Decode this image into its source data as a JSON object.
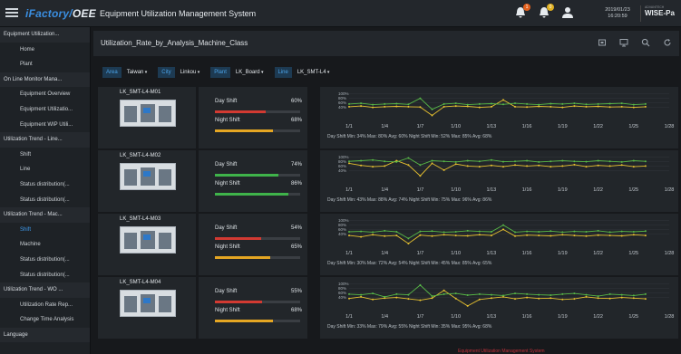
{
  "app": {
    "brand_prefix": "iFactory/",
    "brand_suffix": "OEE",
    "system_title": "Equipment Utilization Management System",
    "date": "2019/01/23",
    "time": "16:20:59",
    "vendor_small": "ADVANTECH",
    "vendor_big": "WISE-Pa",
    "alarm_badge": "1",
    "notice_badge": "0"
  },
  "sidebar": {
    "items": [
      {
        "label": "Equipment Utilization...",
        "level": "head"
      },
      {
        "label": "Home",
        "level": "sub"
      },
      {
        "label": "Plant",
        "level": "sub"
      },
      {
        "label": "On Line Monitor Mana...",
        "level": "head"
      },
      {
        "label": "Equipment Overview",
        "level": "sub"
      },
      {
        "label": "Equipment Utilizatio...",
        "level": "sub"
      },
      {
        "label": "Equipment WIP Utili...",
        "level": "sub"
      },
      {
        "label": "Utilization Trend - Line...",
        "level": "head"
      },
      {
        "label": "Shift",
        "level": "sub"
      },
      {
        "label": "Line",
        "level": "sub"
      },
      {
        "label": "Status distribution(...",
        "level": "sub"
      },
      {
        "label": "Status distribution(...",
        "level": "sub"
      },
      {
        "label": "Utilization Trend - Mac...",
        "level": "head"
      },
      {
        "label": "Shift",
        "level": "sub",
        "active": true
      },
      {
        "label": "Machine",
        "level": "sub"
      },
      {
        "label": "Status distribution(...",
        "level": "sub"
      },
      {
        "label": "Status distribution(...",
        "level": "sub"
      },
      {
        "label": "Utilization Trend - WO ...",
        "level": "head"
      },
      {
        "label": "Utilization Rate Rep...",
        "level": "sub"
      },
      {
        "label": "Change Time Analysis",
        "level": "sub"
      },
      {
        "label": "Language",
        "level": "head"
      }
    ]
  },
  "page": {
    "title": "Utilization_Rate_by_Analysis_Machine_Class"
  },
  "filters": [
    {
      "label": "Area",
      "value": "Taiwan"
    },
    {
      "label": "City",
      "value": "Linkou"
    },
    {
      "label": "Plant",
      "value": "LK_Board"
    },
    {
      "label": "Line",
      "value": "LK_SMT-L4"
    }
  ],
  "colors": {
    "day": "#e7c12f",
    "night": "#58b947",
    "bar_red": "#d23a32",
    "bar_yellow": "#e5a623",
    "bar_green": "#3fb34a"
  },
  "machines": [
    {
      "name": "LK_SMT-L4-M01",
      "day_label": "Day Shift",
      "day_pct": "60%",
      "day_value": 0.6,
      "night_label": "Night Shift",
      "night_pct": "68%",
      "night_value": 0.68,
      "day_bar_color": "#d23a32",
      "night_bar_color": "#e5a623",
      "legend": "Day Shift Min: 34% Max: 80% Avg: 60%  Night Shift Min: 52% Max: 85% Avg: 68%"
    },
    {
      "name": "LK_SMT-L4-M02",
      "day_label": "Day Shift",
      "day_pct": "74%",
      "day_value": 0.74,
      "night_label": "Night Shift",
      "night_pct": "86%",
      "night_value": 0.86,
      "day_bar_color": "#3fb34a",
      "night_bar_color": "#3fb34a",
      "legend": "Day Shift Min: 43% Max: 88% Avg: 74%  Night Shift Min: 75% Max: 96% Avg: 86%"
    },
    {
      "name": "LK_SMT-L4-M03",
      "day_label": "Day Shift",
      "day_pct": "54%",
      "day_value": 0.54,
      "night_label": "Night Shift",
      "night_pct": "65%",
      "night_value": 0.65,
      "day_bar_color": "#d23a32",
      "night_bar_color": "#e5a623",
      "legend": "Day Shift Min: 30% Max: 72% Avg: 54%  Night Shift Min: 45% Max: 85% Avg: 65%"
    },
    {
      "name": "LK_SMT-L4-M04",
      "day_label": "Day Shift",
      "day_pct": "55%",
      "day_value": 0.55,
      "night_label": "Night Shift",
      "night_pct": "68%",
      "night_value": 0.68,
      "day_bar_color": "#d23a32",
      "night_bar_color": "#e5a623",
      "legend": "Day Shift Min: 33% Max: 79% Avg: 55%  Night Shift Min: 35% Max: 95% Avg: 68%"
    }
  ],
  "chart_data": [
    {
      "type": "line",
      "x": [
        "1/1",
        "1/2",
        "1/3",
        "1/4",
        "1/5",
        "1/6",
        "1/7",
        "1/8",
        "1/9",
        "1/10",
        "1/11",
        "1/12",
        "1/13",
        "1/14",
        "1/15",
        "1/16",
        "1/17",
        "1/18",
        "1/19",
        "1/20",
        "1/21",
        "1/22",
        "1/23",
        "1/24",
        "1/25",
        "1/26",
        "1/27",
        "1/28"
      ],
      "xticks": [
        "1/1",
        "1/4",
        "1/7",
        "1/10",
        "1/13",
        "1/16",
        "1/19",
        "1/22",
        "1/25",
        "1/28"
      ],
      "yticks": [
        "100%",
        "80%",
        "60%",
        "40%"
      ],
      "ylim": [
        30,
        100
      ],
      "series": [
        {
          "name": "Day Shift",
          "values": [
            60,
            62,
            58,
            60,
            61,
            60,
            59,
            34,
            60,
            62,
            61,
            58,
            60,
            80,
            60,
            59,
            61,
            60,
            58,
            62,
            60,
            61,
            59,
            60,
            58,
            60,
            null,
            null
          ]
        },
        {
          "name": "Night Shift",
          "values": [
            68,
            70,
            66,
            68,
            69,
            67,
            85,
            52,
            68,
            70,
            66,
            68,
            69,
            67,
            70,
            68,
            66,
            69,
            68,
            70,
            67,
            68,
            69,
            70,
            66,
            68,
            null,
            null
          ]
        }
      ]
    },
    {
      "type": "line",
      "x": [
        "1/1",
        "1/2",
        "1/3",
        "1/4",
        "1/5",
        "1/6",
        "1/7",
        "1/8",
        "1/9",
        "1/10",
        "1/11",
        "1/12",
        "1/13",
        "1/14",
        "1/15",
        "1/16",
        "1/17",
        "1/18",
        "1/19",
        "1/20",
        "1/21",
        "1/22",
        "1/23",
        "1/24",
        "1/25",
        "1/26",
        "1/27",
        "1/28"
      ],
      "xticks": [
        "1/1",
        "1/4",
        "1/7",
        "1/10",
        "1/13",
        "1/16",
        "1/19",
        "1/22",
        "1/25",
        "1/28"
      ],
      "yticks": [
        "100%",
        "80%",
        "60%",
        "40%"
      ],
      "ylim": [
        30,
        100
      ],
      "series": [
        {
          "name": "Day Shift",
          "values": [
            80,
            74,
            70,
            72,
            88,
            75,
            43,
            80,
            60,
            78,
            72,
            70,
            74,
            70,
            75,
            72,
            74,
            70,
            72,
            76,
            70,
            74,
            72,
            75,
            70,
            72,
            null,
            null
          ]
        },
        {
          "name": "Night Shift",
          "values": [
            86,
            88,
            90,
            86,
            84,
            96,
            75,
            88,
            86,
            84,
            88,
            86,
            90,
            85,
            86,
            88,
            84,
            86,
            88,
            86,
            85,
            88,
            86,
            84,
            88,
            86,
            null,
            null
          ]
        }
      ]
    },
    {
      "type": "line",
      "x": [
        "1/1",
        "1/2",
        "1/3",
        "1/4",
        "1/5",
        "1/6",
        "1/7",
        "1/8",
        "1/9",
        "1/10",
        "1/11",
        "1/12",
        "1/13",
        "1/14",
        "1/15",
        "1/16",
        "1/17",
        "1/18",
        "1/19",
        "1/20",
        "1/21",
        "1/22",
        "1/23",
        "1/24",
        "1/25",
        "1/26",
        "1/27",
        "1/28"
      ],
      "xticks": [
        "1/1",
        "1/4",
        "1/7",
        "1/10",
        "1/13",
        "1/16",
        "1/19",
        "1/22",
        "1/25",
        "1/28"
      ],
      "yticks": [
        "100%",
        "80%",
        "60%",
        "40%"
      ],
      "ylim": [
        30,
        100
      ],
      "series": [
        {
          "name": "Day Shift",
          "values": [
            54,
            50,
            56,
            52,
            54,
            30,
            55,
            52,
            56,
            54,
            53,
            56,
            54,
            72,
            52,
            55,
            54,
            53,
            56,
            54,
            52,
            55,
            54,
            53,
            56,
            54,
            null,
            null
          ]
        },
        {
          "name": "Night Shift",
          "values": [
            65,
            66,
            64,
            68,
            65,
            45,
            66,
            67,
            64,
            65,
            68,
            66,
            65,
            85,
            64,
            66,
            65,
            67,
            64,
            66,
            65,
            68,
            64,
            66,
            65,
            67,
            null,
            null
          ]
        }
      ]
    },
    {
      "type": "line",
      "x": [
        "1/1",
        "1/2",
        "1/3",
        "1/4",
        "1/5",
        "1/6",
        "1/7",
        "1/8",
        "1/9",
        "1/10",
        "1/11",
        "1/12",
        "1/13",
        "1/14",
        "1/15",
        "1/16",
        "1/17",
        "1/18",
        "1/19",
        "1/20",
        "1/21",
        "1/22",
        "1/23",
        "1/24",
        "1/25",
        "1/26",
        "1/27",
        "1/28"
      ],
      "xticks": [
        "1/1",
        "1/4",
        "1/7",
        "1/10",
        "1/13",
        "1/16",
        "1/19",
        "1/22",
        "1/25",
        "1/28"
      ],
      "yticks": [
        "100%",
        "80%",
        "60%",
        "40%"
      ],
      "ylim": [
        30,
        100
      ],
      "series": [
        {
          "name": "Day Shift",
          "values": [
            55,
            60,
            52,
            56,
            58,
            54,
            50,
            56,
            79,
            55,
            33,
            52,
            56,
            60,
            54,
            58,
            55,
            56,
            52,
            54,
            60,
            56,
            55,
            58,
            56,
            54,
            null,
            null
          ]
        },
        {
          "name": "Night Shift",
          "values": [
            68,
            66,
            70,
            60,
            68,
            66,
            95,
            62,
            68,
            70,
            65,
            68,
            66,
            64,
            70,
            68,
            66,
            65,
            68,
            70,
            66,
            62,
            68,
            66,
            64,
            68,
            null,
            null
          ]
        }
      ]
    }
  ],
  "footer": {
    "text": "Equipment Utilization Management System"
  }
}
